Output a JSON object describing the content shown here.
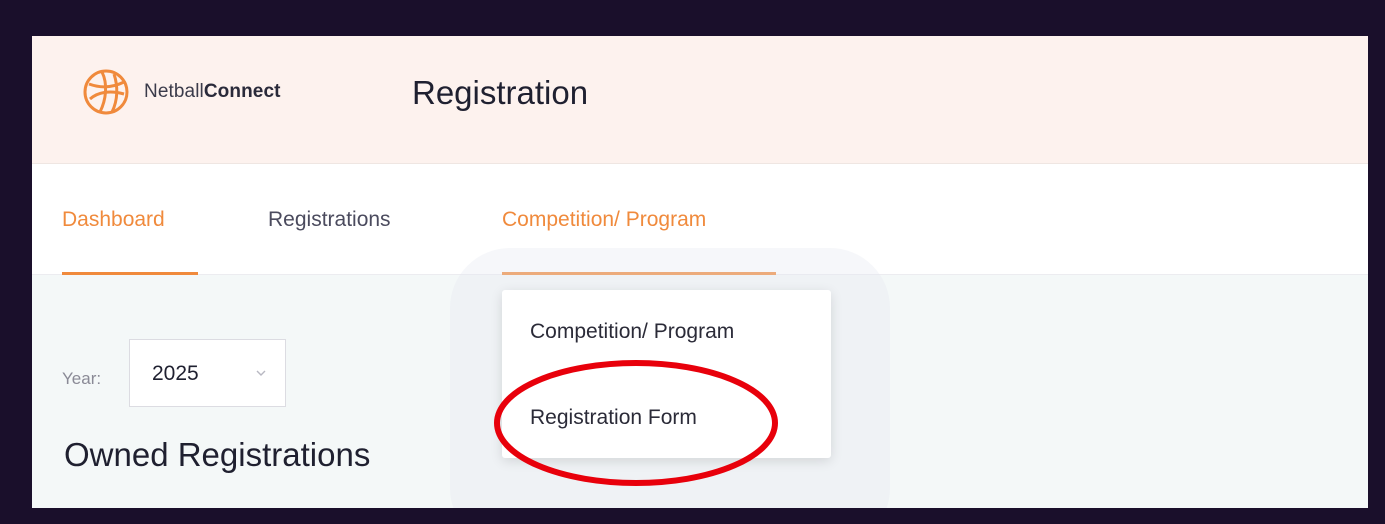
{
  "header": {
    "brand_regular": "Netball",
    "brand_bold": "Connect",
    "title": "Registration"
  },
  "nav": {
    "items": [
      {
        "label": "Dashboard"
      },
      {
        "label": "Registrations"
      },
      {
        "label": "Competition/ Program"
      }
    ]
  },
  "dropdown": {
    "items": [
      {
        "label": "Competition/ Program"
      },
      {
        "label": "Registration Form"
      }
    ]
  },
  "filters": {
    "year_label": "Year:",
    "year_value": "2025"
  },
  "section": {
    "title": "Owned Registrations"
  },
  "icons": {
    "logo": "netball-logo-icon",
    "chevron": "chevron-down-icon"
  },
  "colors": {
    "accent": "#f08a3c",
    "highlight_ring": "#e8000b",
    "header_bg": "#fdf2ee",
    "page_bg": "#f4f8f8"
  }
}
